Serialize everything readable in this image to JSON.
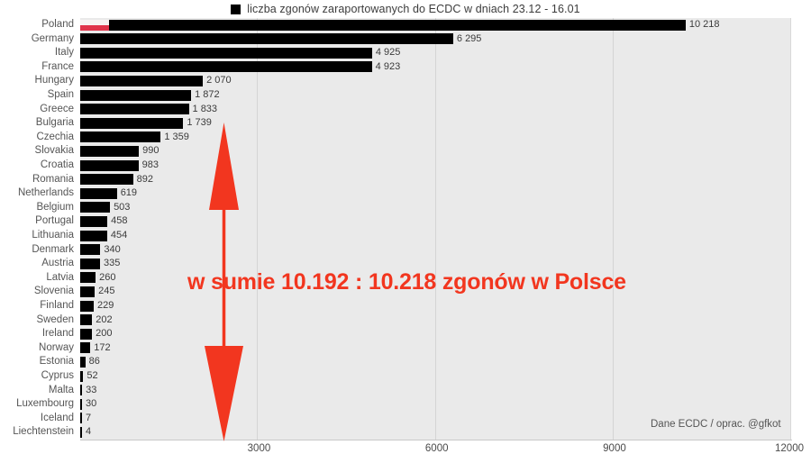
{
  "legend": {
    "label": "liczba zgonów zaraportowanych do ECDC w dniach 23.12 - 16.01",
    "swatch_color": "#000000",
    "icon": "square-swatch-icon"
  },
  "credit": "Dane ECDC / oprac. @gfkot",
  "annotation": {
    "text": "w sumie 10.192 : 10.218 zgonów w Polsce",
    "color": "#f2361f",
    "arrow_icon": "double-headed-vertical-arrow-icon"
  },
  "highlight": {
    "country": "Poland",
    "flag_white": "#f7f2f2",
    "flag_red": "#e0334a"
  },
  "chart_data": {
    "type": "bar",
    "orientation": "horizontal",
    "title": "liczba zgonów zaraportowanych do ECDC w dniach 23.12 - 16.01",
    "xlabel": "",
    "ylabel": "",
    "xlim": [
      0,
      12000
    ],
    "xticks": [
      3000,
      6000,
      9000,
      12000
    ],
    "xtick_labels": [
      "3000",
      "6000",
      "9000",
      "12000"
    ],
    "grid": true,
    "legend_position": "top-center",
    "bar_color": "#000000",
    "plot_background": "#eaeaea",
    "categories": [
      "Poland",
      "Germany",
      "Italy",
      "France",
      "Hungary",
      "Spain",
      "Greece",
      "Bulgaria",
      "Czechia",
      "Slovakia",
      "Croatia",
      "Romania",
      "Netherlands",
      "Belgium",
      "Portugal",
      "Lithuania",
      "Denmark",
      "Austria",
      "Latvia",
      "Slovenia",
      "Finland",
      "Sweden",
      "Ireland",
      "Norway",
      "Estonia",
      "Cyprus",
      "Malta",
      "Luxembourg",
      "Iceland",
      "Liechtenstein"
    ],
    "values": [
      10218,
      6295,
      4925,
      4923,
      2070,
      1872,
      1833,
      1739,
      1359,
      990,
      983,
      892,
      619,
      503,
      458,
      454,
      340,
      335,
      260,
      245,
      229,
      202,
      200,
      172,
      86,
      52,
      33,
      30,
      7,
      4
    ],
    "value_labels": [
      "10 218",
      "6 295",
      "4 925",
      "4 923",
      "2 070",
      "1 872",
      "1 833",
      "1 739",
      "1 359",
      "990",
      "983",
      "892",
      "619",
      "503",
      "458",
      "454",
      "340",
      "335",
      "260",
      "245",
      "229",
      "202",
      "200",
      "172",
      "86",
      "52",
      "33",
      "30",
      "7",
      "4"
    ]
  }
}
